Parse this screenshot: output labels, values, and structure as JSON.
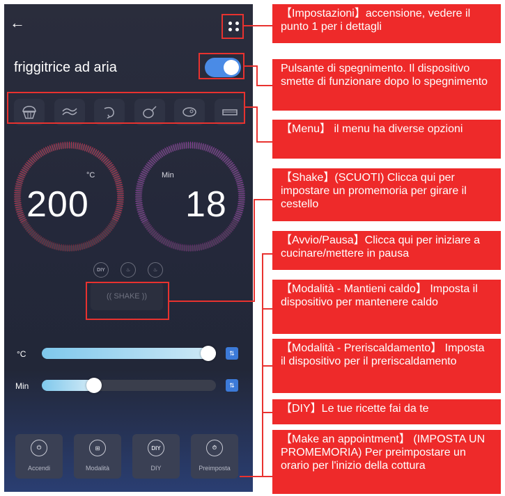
{
  "app": {
    "title": "friggitrice ad aria",
    "back_icon": "arrow-left-icon",
    "settings_icon": "four-dots-icon",
    "power_on": true,
    "accent_color": "#4a8be6"
  },
  "menu": {
    "items": [
      {
        "icon": "muffin-icon"
      },
      {
        "icon": "bacon-icon"
      },
      {
        "icon": "shrimp-icon"
      },
      {
        "icon": "chicken-leg-icon"
      },
      {
        "icon": "steak-icon"
      },
      {
        "icon": "fish-icon"
      }
    ]
  },
  "dials": {
    "temperature": {
      "unit": "°C",
      "value": "200"
    },
    "time": {
      "unit": "Min",
      "value": "18"
    }
  },
  "modes": {
    "diy_label": "DIY",
    "icons": [
      "diy-icon",
      "flame-icon",
      "keep-warm-icon"
    ]
  },
  "shake": {
    "label": "((  SHAKE  ))"
  },
  "sliders": {
    "temperature": {
      "label": "°C",
      "level": 1.0
    },
    "time": {
      "label": "Min",
      "level": 0.28
    }
  },
  "bottom_buttons": [
    {
      "label": "Accendi",
      "icon": "power-icon"
    },
    {
      "label": "Modalità",
      "icon": "grid-icon"
    },
    {
      "label": "DIY",
      "icon": "diy-icon"
    },
    {
      "label": "Preimposta",
      "icon": "timer-icon"
    }
  ],
  "annotations": {
    "settings": "【Impostazioni】accensione, vedere il punto 1 per i dettagli",
    "power": "Pulsante di spegnimento. Il dispositivo smette di funzionare dopo lo spegnimento",
    "menu": "【Menu】 il menu ha diverse opzioni",
    "shake": "【Shake】(SCUOTI) Clicca qui per impostare un promemoria per girare il cestello",
    "start_pause": "【Avvio/Pausa】Clicca qui per iniziare a cucinare/mettere in pausa",
    "keep_warm": "【Modalità - Mantieni caldo】 Imposta il dispositivo per mantenere caldo",
    "preheat": "【Modalità - Preriscaldamento】 Imposta il dispositivo per il preriscaldamento",
    "diy": "【DIY】Le tue ricette fai da te",
    "appointment": "【Make an appointment】 (IMPOSTA UN PROMEMORIA) Per preimpostare un orario per l'inizio della cottura"
  },
  "colors": {
    "callout_red": "#ee2a2a",
    "highlight_red": "#e8322f"
  }
}
